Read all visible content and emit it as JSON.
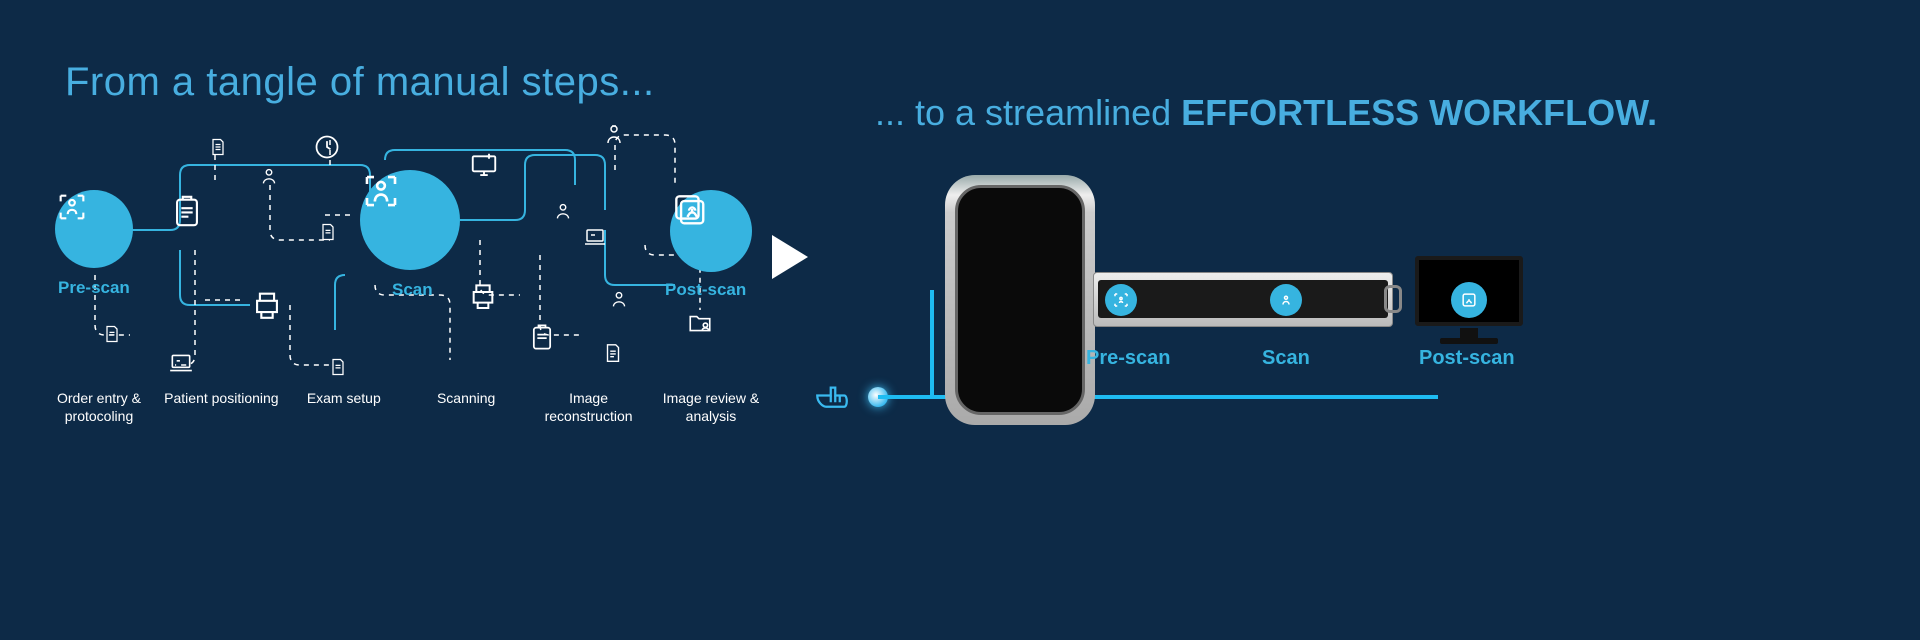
{
  "left_title": "From a tangle of manual steps...",
  "right_title_prefix": "... to a streamlined ",
  "right_title_bold": "EFFORTLESS WORKFLOW.",
  "left_phases": {
    "pre": "Pre-scan",
    "scan": "Scan",
    "post": "Post-scan"
  },
  "steps": {
    "s1": "Order entry & protocoling",
    "s2": "Patient positioning",
    "s3": "Exam setup",
    "s4": "Scanning",
    "s5": "Image reconstruction",
    "s6": "Image review & analysis"
  },
  "right_phases": {
    "pre": "Pre-scan",
    "scan": "Scan",
    "post": "Post-scan"
  },
  "colors": {
    "bg": "#0d2a47",
    "accent": "#36b4e0",
    "accent_light": "#48aee0",
    "line_glow": "#1ebcf2"
  }
}
